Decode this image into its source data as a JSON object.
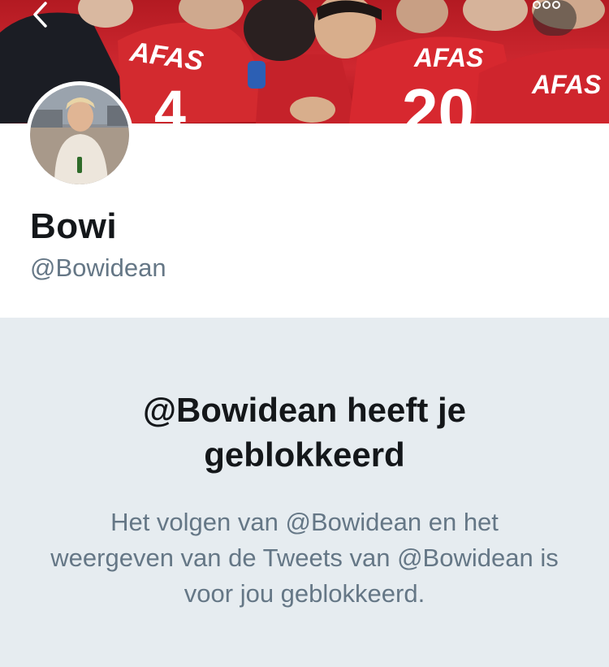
{
  "header": {
    "back_icon": "chevron-left-icon",
    "more_icon": "more-horizontal-icon",
    "banner_shirt_text": "AFAS",
    "banner_numbers": [
      "4",
      "20"
    ]
  },
  "profile": {
    "display_name": "Bowi",
    "handle": "@Bowidean"
  },
  "blocked": {
    "title": "@Bowidean heeft je geblokkeerd",
    "body": "Het volgen van @Bowidean en het weergeven van de Tweets van @Bowidean is voor jou geblokkeerd."
  },
  "colors": {
    "primary_text": "#14171a",
    "secondary_text": "#657786",
    "background": "#e6ecf0",
    "banner_red": "#cf2830"
  }
}
